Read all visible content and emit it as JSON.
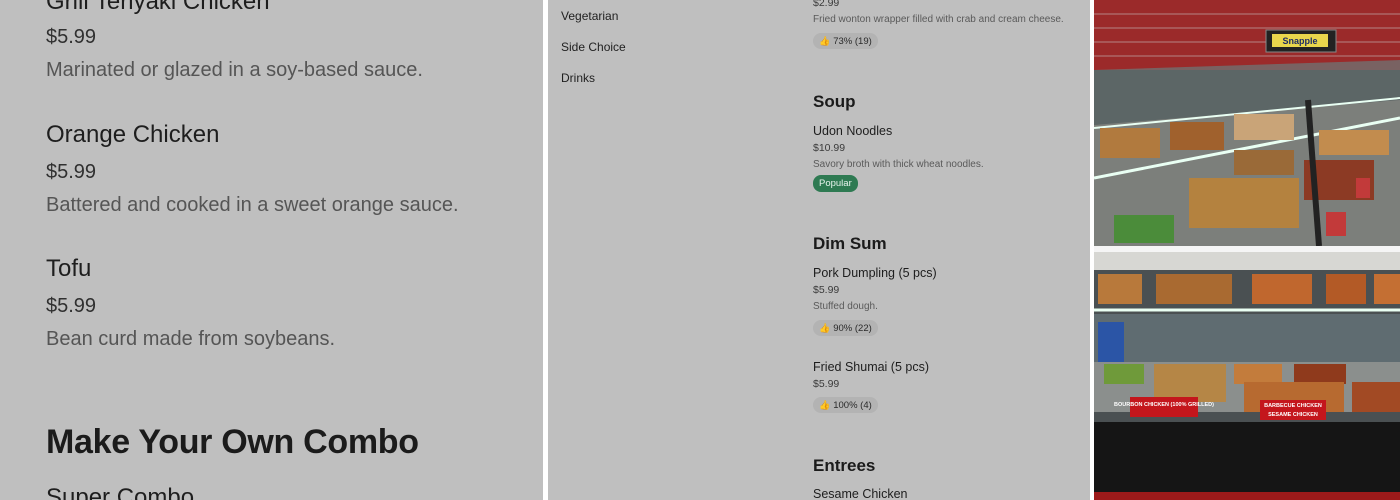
{
  "left": {
    "items": [
      {
        "name": "Grill Teriyaki Chicken",
        "price": "$5.99",
        "desc": "Marinated or glazed in a soy-based sauce."
      },
      {
        "name": "Orange Chicken",
        "price": "$5.99",
        "desc": "Battered and cooked in a sweet orange sauce."
      },
      {
        "name": "Tofu",
        "price": "$5.99",
        "desc": "Bean curd made from soybeans."
      }
    ],
    "section_heading": "Make Your Own Combo",
    "next_item": "Super Combo"
  },
  "middle": {
    "categories": [
      "Vegetarian",
      "Side Choice",
      "Drinks"
    ],
    "top_item": {
      "price": "$2.99",
      "desc": "Fried wonton wrapper filled with crab and cream cheese.",
      "rating": "73% (19)"
    },
    "soup": {
      "title": "Soup",
      "name": "Udon Noodles",
      "price": "$10.99",
      "desc": "Savory broth with thick wheat noodles.",
      "badge": "Popular"
    },
    "dimsum": {
      "title": "Dim Sum",
      "items": [
        {
          "name": "Pork Dumpling (5 pcs)",
          "price": "$5.99",
          "desc": "Stuffed dough.",
          "rating": "90% (22)"
        },
        {
          "name": "Fried Shumai (5 pcs)",
          "price": "$5.99",
          "rating": "100% (4)"
        }
      ]
    },
    "entrees": {
      "title": "Entrees",
      "first": "Sesame Chicken"
    }
  },
  "right": {
    "top_sign": "Snapple",
    "labels": [
      "BOURBON CHICKEN (100% GRILLED)",
      "BARBECUE CHICKEN",
      "SESAME CHICKEN"
    ]
  },
  "colors": {
    "popular": "#2e7a52",
    "overlay": "#bfbfbf"
  }
}
